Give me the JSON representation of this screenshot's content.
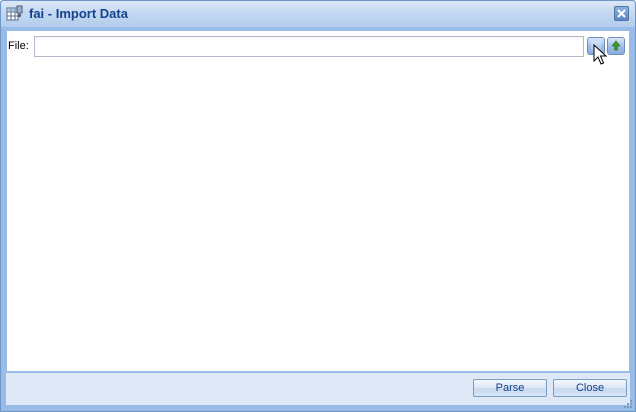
{
  "window": {
    "title": "fai - Import Data"
  },
  "form": {
    "file_label": "File:",
    "file_value": "",
    "file_placeholder": ""
  },
  "footer": {
    "parse_label": "Parse",
    "close_label": "Close"
  },
  "icons": {
    "app": "table-grid-icon",
    "close": "close-x-icon",
    "pick": "browse-icon",
    "upload": "upload-arrow-icon",
    "resize": "resize-grip-icon"
  },
  "colors": {
    "title_text": "#15428b",
    "frame": "#99bbe8",
    "footer_bg": "#dfe8f6",
    "upload_arrow": "#3a9a2a"
  }
}
